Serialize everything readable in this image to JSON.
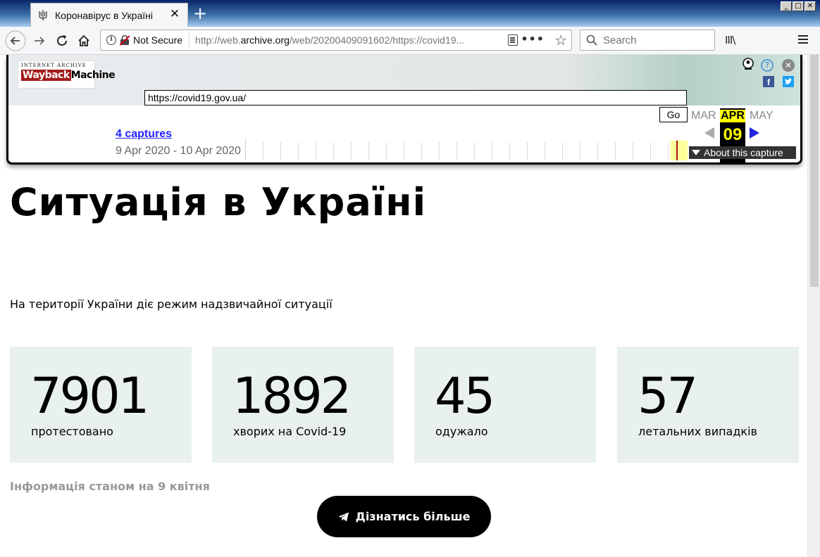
{
  "browser": {
    "tab_title": "Коронавірус в Україні",
    "tab_close": "✕",
    "new_tab": "+",
    "not_secure": "Not Secure",
    "url_prefix": "http://web.",
    "url_domain": "archive.org",
    "url_suffix": "/web/20200409091602/https://covid19...",
    "search_placeholder": "Search",
    "library": "III\\",
    "window_buttons": [
      "_",
      "□",
      "✕"
    ]
  },
  "wayback": {
    "logo_top": "INTERNET ARCHIVE",
    "logo_main_1": "Wayback",
    "logo_main_2": "Machine",
    "url_value": "https://covid19.gov.ua/",
    "go": "Go",
    "captures": "4 captures",
    "range": "9 Apr 2020 - 10 Apr 2020",
    "month_prev": "MAR",
    "month_current": "APR",
    "month_next": "MAY",
    "day": "09",
    "about": "About this capture",
    "help": "?",
    "close": "✕",
    "facebook": "f"
  },
  "page": {
    "heading": "Ситуація в Україні",
    "notice": "На території України діє режим надзвичайної ситуації",
    "stats": [
      {
        "value": "7901",
        "label": "протестовано"
      },
      {
        "value": "1892",
        "label": "хворих на Covid-19"
      },
      {
        "value": "45",
        "label": "одужало"
      },
      {
        "value": "57",
        "label": "летальних випадків"
      }
    ],
    "updated": "Інформація станом на 9 квітня",
    "cta_label": "Дізнатись більше"
  },
  "colors": {
    "stat_card_bg": "#e9f1ee",
    "cta_bg": "#000000",
    "capture_link": "#2323ff",
    "current_month_bg": "#ffff00"
  }
}
